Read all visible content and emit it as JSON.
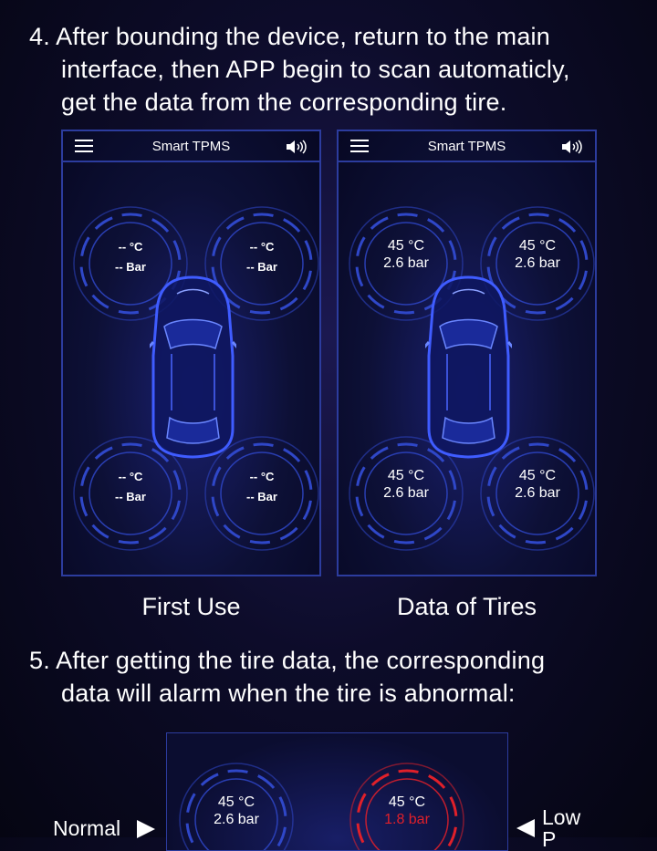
{
  "step4": {
    "lines": [
      "4. After bounding the device, return to the main",
      "interface, then APP begin to scan automaticly,",
      "get the data from the corresponding tire."
    ]
  },
  "screens": [
    {
      "title": "Smart TPMS",
      "caption": "First Use",
      "tires": [
        {
          "temp": "-- °C",
          "pressure": "-- Bar"
        },
        {
          "temp": "-- °C",
          "pressure": "-- Bar"
        },
        {
          "temp": "-- °C",
          "pressure": "-- Bar"
        },
        {
          "temp": "-- °C",
          "pressure": "-- Bar"
        }
      ]
    },
    {
      "title": "Smart TPMS",
      "caption": "Data of Tires",
      "tires": [
        {
          "temp": "45 °C",
          "pressure": "2.6 bar"
        },
        {
          "temp": "45 °C",
          "pressure": "2.6 bar"
        },
        {
          "temp": "45 °C",
          "pressure": "2.6 bar"
        },
        {
          "temp": "45 °C",
          "pressure": "2.6 bar"
        }
      ]
    }
  ],
  "step5": {
    "lines": [
      "5. After getting the tire data, the corresponding",
      "data will alarm when the tire is abnormal:"
    ]
  },
  "alarm_demo": {
    "normal_label": "Normal",
    "low_label": "Low",
    "low_label_second_line": "P",
    "normal_tire": {
      "temp": "45 °C",
      "pressure": "2.6 bar"
    },
    "alarm_tire": {
      "temp": "45 °C",
      "pressure": "1.8 bar"
    }
  },
  "colors": {
    "accent": "#2c3c9e",
    "ring_normal": "#2f47c8",
    "ring_alarm": "#e0202a"
  },
  "icons": {
    "menu": "menu-icon",
    "speaker": "speaker-icon",
    "play_right": "triangle-right-icon",
    "play_left": "triangle-left-icon"
  }
}
